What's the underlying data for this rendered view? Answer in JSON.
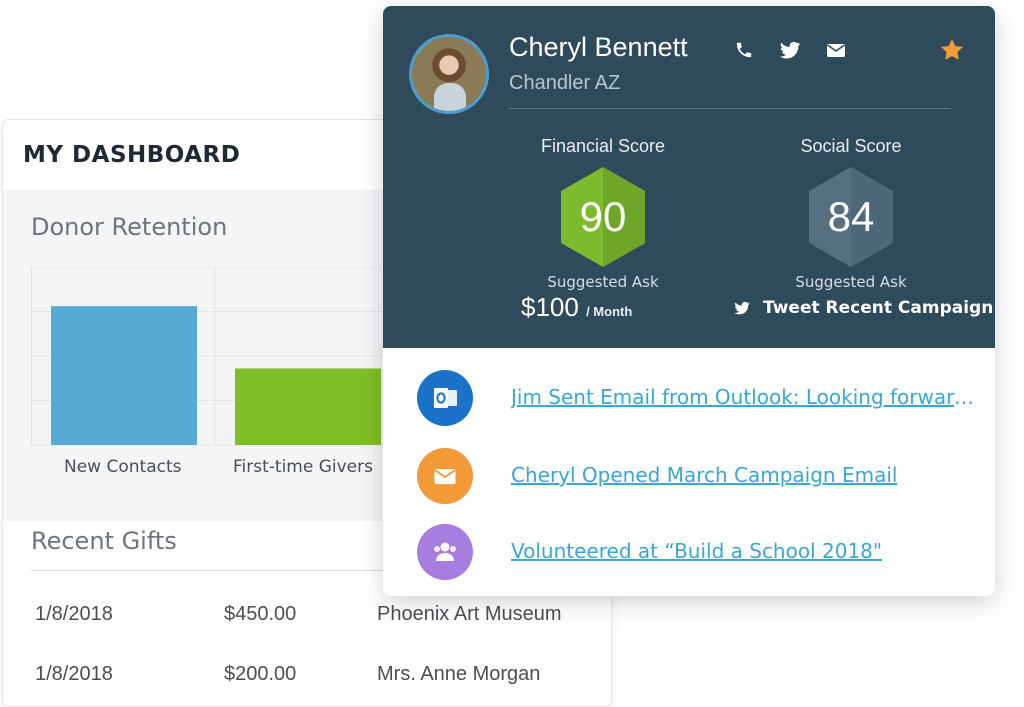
{
  "dashboard": {
    "title": "MY DASHBOARD",
    "retention": {
      "title": "Donor Retention"
    },
    "recent_gifts": {
      "title": "Recent Gifts",
      "rows": [
        {
          "date": "1/8/2018",
          "amount": "$450.00",
          "org": "Phoenix Art Museum"
        },
        {
          "date": "1/8/2018",
          "amount": "$200.00",
          "org": "Mrs. Anne Morgan"
        }
      ]
    }
  },
  "chart_data": {
    "type": "bar",
    "title": "Donor Retention",
    "categories": [
      "New Contacts",
      "First-time Givers"
    ],
    "values": [
      78,
      43
    ],
    "colors": [
      "#56abd6",
      "#80be28"
    ],
    "ylim": [
      0,
      100
    ],
    "xlabel": "",
    "ylabel": "",
    "grid": true
  },
  "contact": {
    "name": "Cheryl Bennett",
    "location": "Chandler AZ",
    "icons": [
      "phone-icon",
      "twitter-icon",
      "email-icon",
      "star-icon"
    ],
    "financial": {
      "title": "Financial Score",
      "score": "90",
      "color": "#7dbb2e",
      "suggested_label": "Suggested Ask",
      "ask_amount": "$100",
      "ask_unit": "/ Month"
    },
    "social": {
      "title": "Social Score",
      "score": "84",
      "color": "#4e6878",
      "suggested_label": "Suggested Ask",
      "action": "Tweet Recent Campaign"
    },
    "activities": [
      {
        "icon": "outlook-icon",
        "color": "#1a73c8",
        "text": "Jim Sent Email from Outlook: Looking forward..."
      },
      {
        "icon": "envelope-icon",
        "color": "#f29a38",
        "text": "Cheryl Opened March Campaign Email"
      },
      {
        "icon": "group-icon",
        "color": "#a77de0",
        "text": "Volunteered at “Build a School 2018\""
      }
    ]
  },
  "colors": {
    "card_header": "#2f4a5a",
    "link": "#3aa6d6",
    "star": "#f29a38"
  }
}
